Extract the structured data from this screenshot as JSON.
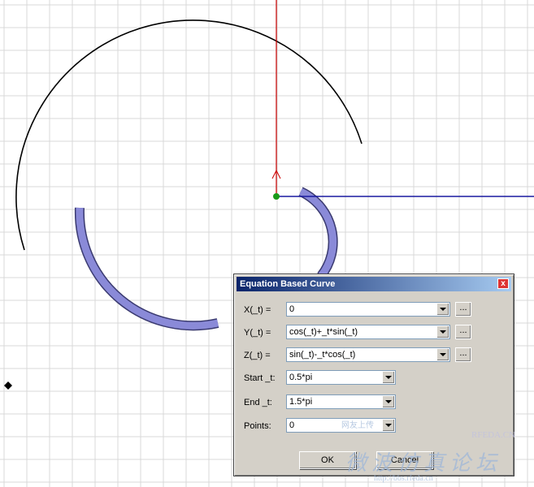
{
  "dialog": {
    "title": "Equation Based Curve",
    "fields": [
      {
        "label": "X(_t) =",
        "value": "0",
        "has_ellipsis": true
      },
      {
        "label": "Y(_t) =",
        "value": "cos(_t)+_t*sin(_t)",
        "has_ellipsis": true
      },
      {
        "label": "Z(_t) =",
        "value": "sin(_t)-_t*cos(_t)",
        "has_ellipsis": true
      },
      {
        "label": "Start _t:",
        "value": "0.5*pi",
        "has_ellipsis": false
      },
      {
        "label": "End _t:",
        "value": "1.5*pi",
        "has_ellipsis": false
      },
      {
        "label": "Points:",
        "value": "0",
        "has_ellipsis": false
      }
    ],
    "ellipsis_label": "...",
    "ok_label": "OK",
    "cancel_label": "Cancel",
    "close_label": "x"
  },
  "watermark": {
    "brand": "RFEDA.CN",
    "cn_text": "微波仿真论坛",
    "url": "http://bbs.rfeda.cn",
    "small_text": "网友上传"
  },
  "colors": {
    "grid": "#d8d8d8",
    "axis_red": "#cc0000",
    "axis_blue": "#1a1aa0",
    "helix": "#8a8ad8",
    "origin": "#1a9a1a"
  }
}
